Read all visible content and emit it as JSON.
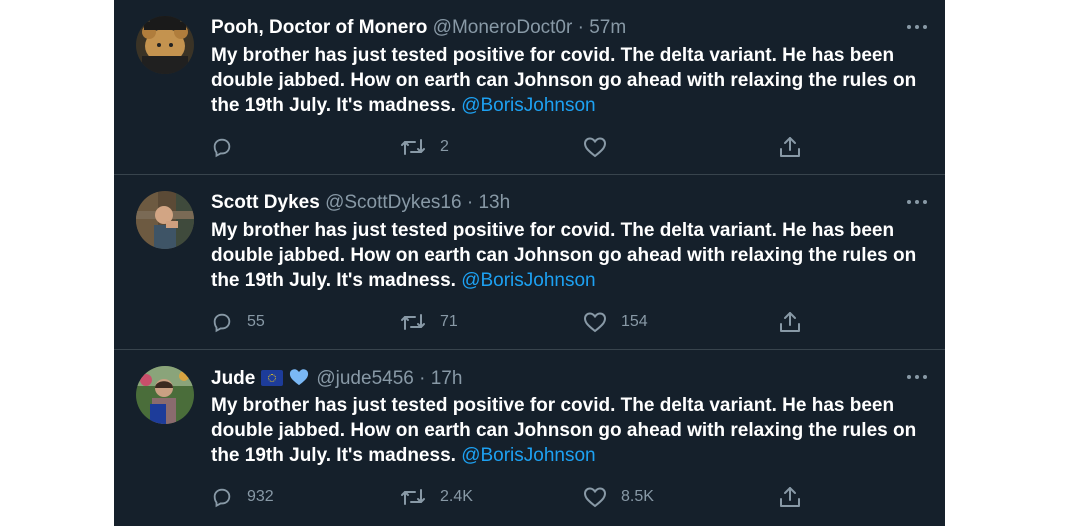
{
  "tweets": [
    {
      "name": "Pooh, Doctor of Monero",
      "handle": "@MoneroDoct0r",
      "separator": "·",
      "time": "57m",
      "text": "My brother has just tested positive for covid. The delta variant. He has been double jabbed. How on earth can Johnson go ahead with relaxing the rules on the 19th July. It's madness.",
      "mention": "@BorisJohnson",
      "replies": "",
      "retweets": "2",
      "likes": ""
    },
    {
      "name": "Scott Dykes",
      "handle": "@ScottDykes16",
      "separator": "·",
      "time": "13h",
      "text": "My brother has just tested positive for covid. The delta variant. He has been double jabbed. How on earth can Johnson go ahead with relaxing the rules on the 19th July. It's madness.",
      "mention": "@BorisJohnson",
      "replies": "55",
      "retweets": "71",
      "likes": "154"
    },
    {
      "name": "Jude",
      "handle": "@jude5456",
      "separator": "·",
      "time": "17h",
      "text": "My brother has just tested positive for covid. The delta variant. He has been double jabbed. How on earth can Johnson go ahead with relaxing the rules on the 19th July. It's madness.",
      "mention": "@BorisJohnson",
      "replies": "932",
      "retweets": "2.4K",
      "likes": "8.5K"
    }
  ],
  "icons": {
    "reply": "reply-icon",
    "retweet": "retweet-icon",
    "like": "heart-icon",
    "share": "share-icon",
    "more": "more-icon"
  },
  "colors": {
    "background": "#15202b",
    "divider": "#38444d",
    "text": "#ffffff",
    "secondary": "#8899a6",
    "link": "#1da1f2"
  }
}
